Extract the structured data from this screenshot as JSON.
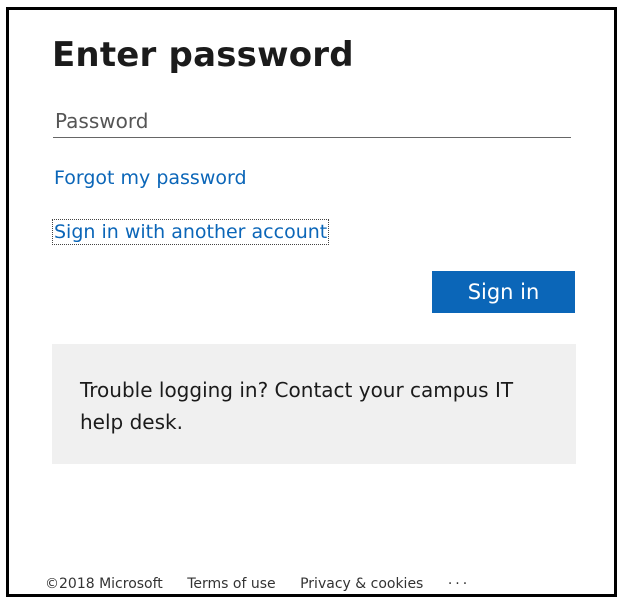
{
  "signin": {
    "title": "Enter password",
    "password_placeholder": "Password",
    "password_value": "",
    "forgot_link": "Forgot my password",
    "another_account_link": "Sign in with another account",
    "signin_button": "Sign in"
  },
  "help": {
    "text": "Trouble logging in? Contact your campus IT help desk."
  },
  "footer": {
    "copyright": "©2018 Microsoft",
    "terms": "Terms of use",
    "privacy": "Privacy & cookies",
    "more": "···"
  },
  "colors": {
    "accent": "#0b66b8",
    "help_background": "#f0f0f0",
    "text": "#1b1b1b"
  }
}
